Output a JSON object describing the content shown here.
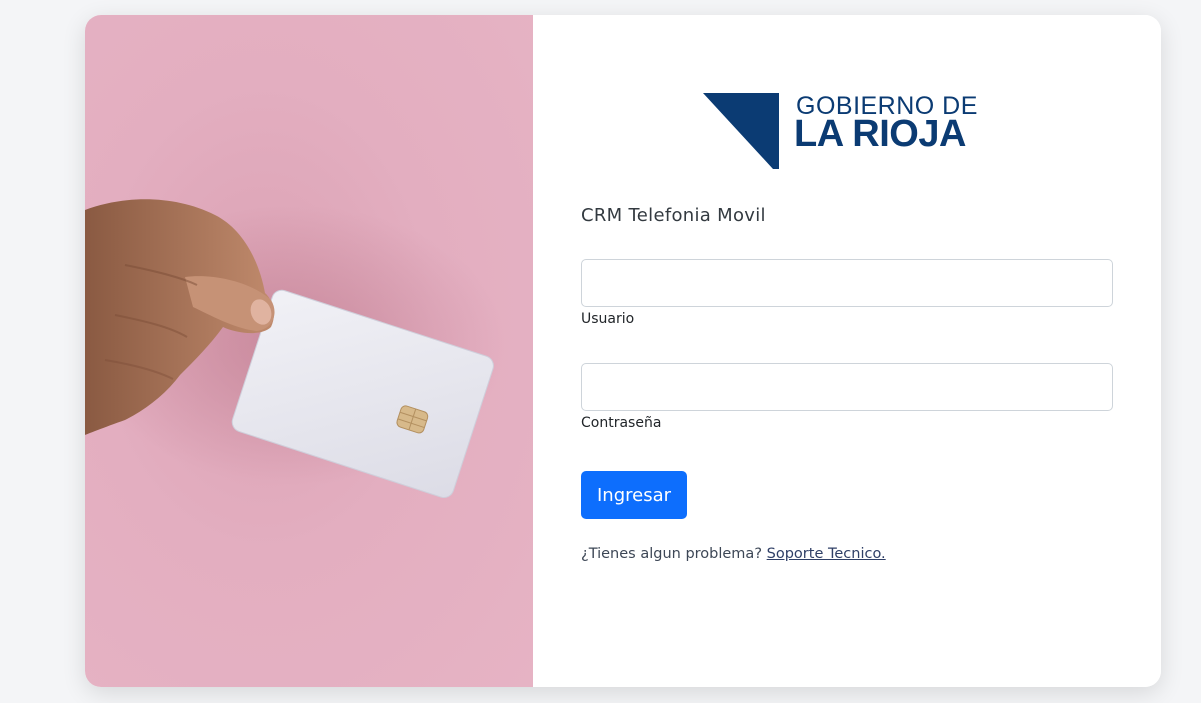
{
  "brand": {
    "line1": "GOBIERNO DE",
    "line2": "LA RIOJA",
    "color": "#0b3b73"
  },
  "app_title": "CRM Telefonia Movil",
  "form": {
    "username": {
      "label": "Usuario",
      "value": "",
      "placeholder": ""
    },
    "password": {
      "label": "Contraseña",
      "value": "",
      "placeholder": ""
    },
    "submit_label": "Ingresar",
    "submit_color": "#0d6efd"
  },
  "help": {
    "text": "¿Tienes algun problema?",
    "link_label": "Soporte Tecnico."
  },
  "hero": {
    "icon": "hand-holding-card-photo",
    "background_color": "#e4afc1"
  }
}
